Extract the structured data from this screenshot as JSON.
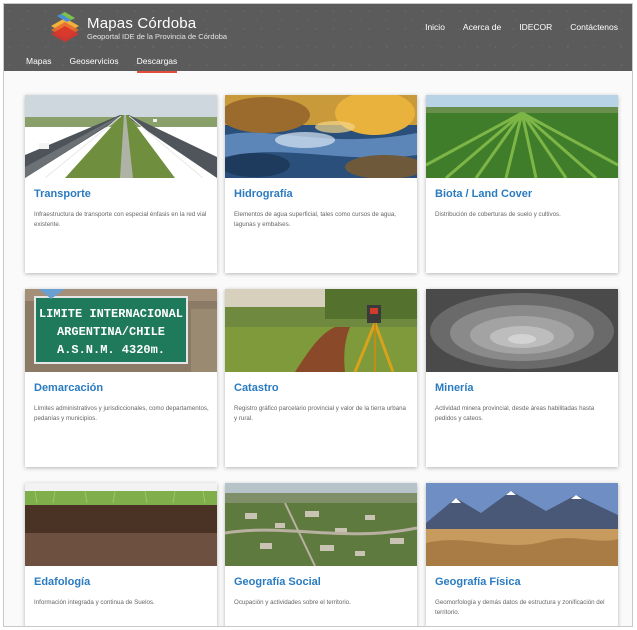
{
  "header": {
    "brand_title": "Mapas Córdoba",
    "brand_subtitle": "Geoportal IDE de la Provincia de Córdoba",
    "top_nav": [
      "Inicio",
      "Acerca de",
      "IDECOR",
      "Contáctenos"
    ],
    "main_nav": [
      {
        "label": "Mapas",
        "active": false
      },
      {
        "label": "Geoservicios",
        "active": false
      },
      {
        "label": "Descargas",
        "active": true
      }
    ],
    "accent_color": "#e24c3a",
    "title_color": "#2a7bc0"
  },
  "cards": [
    {
      "title": "Transporte",
      "description": "Infraestructura de transporte con especial énfasis en la red vial existente.",
      "image": "highway-photo"
    },
    {
      "title": "Hidrografía",
      "description": "Elementos de agua superficial, tales como cursos de agua, lagunas y embalses.",
      "image": "river-photo"
    },
    {
      "title": "Biota / Land Cover",
      "description": "Distribución de coberturas de suelo y cultivos.",
      "image": "crop-field-photo"
    },
    {
      "title": "Demarcación",
      "description": "Límites administrativos y jurisdiccionales, como departamentos, pedanías y municipios.",
      "image": "border-sign-photo",
      "sign_lines": [
        "LIMITE INTERNACIONAL",
        "ARGENTINA/CHILE",
        "A.S.N.M.  4320m."
      ]
    },
    {
      "title": "Catastro",
      "description": "Registro gráfico parcelario provincial y valor de la tierra urbana y rural.",
      "image": "surveying-instrument-photo"
    },
    {
      "title": "Minería",
      "description": "Actividad minera provincial, desde áreas habilitadas hasta pedidos y cateos.",
      "image": "open-pit-mine-photo"
    },
    {
      "title": "Edafología",
      "description": "Información integrada y continua de Suelos.",
      "image": "soil-profile-photo"
    },
    {
      "title": "Geografía Social",
      "description": "Ocupación y actividades sobre el territorio.",
      "image": "aerial-town-photo"
    },
    {
      "title": "Geografía Física",
      "description": "Geomorfología y demás datos de estructura y zonificación del territorio.",
      "image": "dunes-mountains-photo"
    }
  ]
}
